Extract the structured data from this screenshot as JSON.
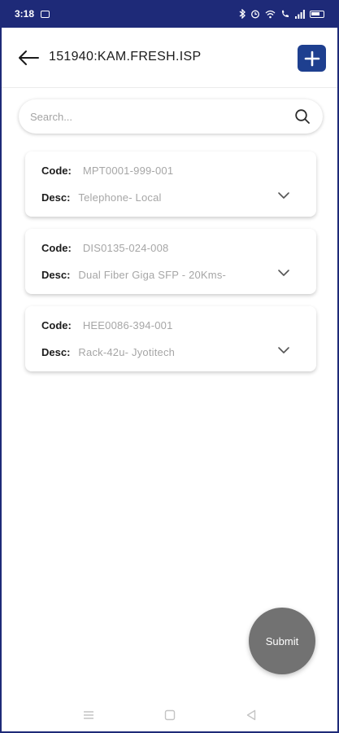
{
  "statusbar": {
    "time": "3:18",
    "icons": [
      "message-icon",
      "bluetooth-icon",
      "alarm-icon",
      "wifi-icon",
      "call-icon",
      "signal-icon",
      "battery-icon"
    ]
  },
  "header": {
    "title": "151940:KAM.FRESH.ISP",
    "back_icon": "arrow-left-icon",
    "add_icon": "plus-icon"
  },
  "search": {
    "placeholder": "Search...",
    "value": "",
    "icon": "search-icon"
  },
  "items": [
    {
      "code_label": "Code:",
      "code": "MPT0001-999-001",
      "desc_label": "Desc:",
      "desc": "Telephone- Local"
    },
    {
      "code_label": "Code:",
      "code": "DIS0135-024-008",
      "desc_label": "Desc:",
      "desc": "Dual Fiber Giga SFP - 20Kms-"
    },
    {
      "code_label": "Code:",
      "code": "HEE0086-394-001",
      "desc_label": "Desc:",
      "desc": "Rack-42u- Jyotitech"
    }
  ],
  "submit_label": "Submit",
  "navbar": {
    "icons": [
      "menu-icon",
      "home-square-icon",
      "back-triangle-icon"
    ]
  },
  "colors": {
    "statusbar": "#1e2a78",
    "accent": "#1e3f8f",
    "submit": "#727272"
  }
}
